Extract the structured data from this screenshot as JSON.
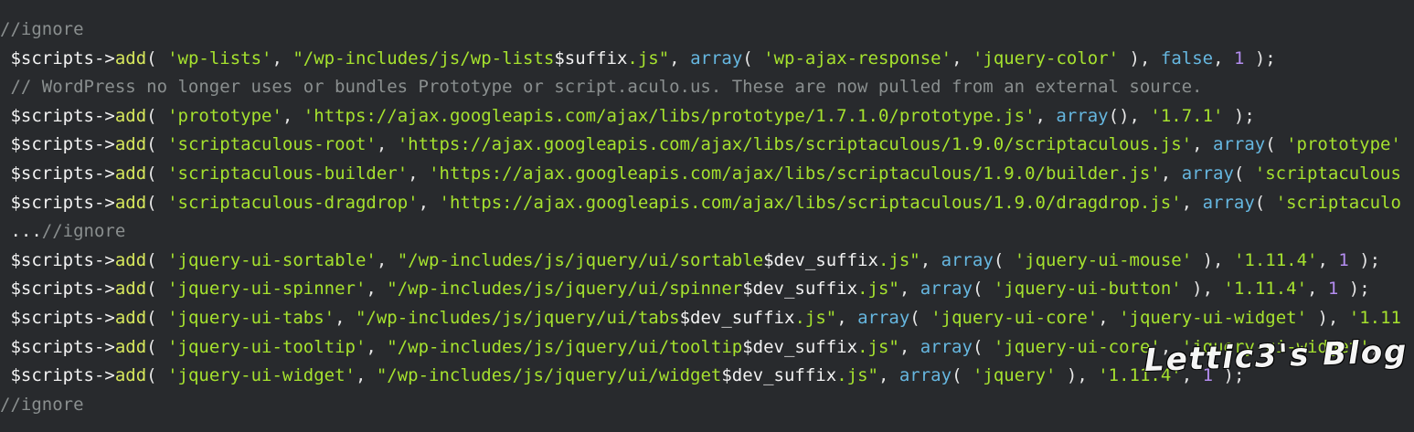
{
  "watermark": "Lettic3's Blog",
  "lines": [
    [
      [
        "com",
        "//ignore"
      ]
    ],
    [
      [
        "var",
        " $scripts->"
      ],
      [
        "fn",
        "add"
      ],
      [
        "plain",
        "( "
      ],
      [
        "str",
        "'wp-lists'"
      ],
      [
        "plain",
        ", "
      ],
      [
        "str",
        "\"/wp-includes/js/wp-lists"
      ],
      [
        "var",
        "$suffix"
      ],
      [
        "str",
        ".js\""
      ],
      [
        "plain",
        ", "
      ],
      [
        "kw",
        "array"
      ],
      [
        "plain",
        "( "
      ],
      [
        "str",
        "'wp-ajax-response'"
      ],
      [
        "plain",
        ", "
      ],
      [
        "str",
        "'jquery-color'"
      ],
      [
        "plain",
        " ), "
      ],
      [
        "kw",
        "false"
      ],
      [
        "plain",
        ", "
      ],
      [
        "num",
        "1"
      ],
      [
        "plain",
        " );"
      ]
    ],
    [
      [
        "com",
        " // WordPress no longer uses or bundles Prototype or script.aculo.us. These are now pulled from an external source."
      ]
    ],
    [
      [
        "var",
        " $scripts->"
      ],
      [
        "fn",
        "add"
      ],
      [
        "plain",
        "( "
      ],
      [
        "str",
        "'prototype'"
      ],
      [
        "plain",
        ", "
      ],
      [
        "str",
        "'https://ajax.googleapis.com/ajax/libs/prototype/1.7.1.0/prototype.js'"
      ],
      [
        "plain",
        ", "
      ],
      [
        "kw",
        "array"
      ],
      [
        "plain",
        "(), "
      ],
      [
        "str",
        "'1.7.1'"
      ],
      [
        "plain",
        " );"
      ]
    ],
    [
      [
        "var",
        " $scripts->"
      ],
      [
        "fn",
        "add"
      ],
      [
        "plain",
        "( "
      ],
      [
        "str",
        "'scriptaculous-root'"
      ],
      [
        "plain",
        ", "
      ],
      [
        "str",
        "'https://ajax.googleapis.com/ajax/libs/scriptaculous/1.9.0/scriptaculous.js'"
      ],
      [
        "plain",
        ", "
      ],
      [
        "kw",
        "array"
      ],
      [
        "plain",
        "( "
      ],
      [
        "str",
        "'prototype'"
      ]
    ],
    [
      [
        "var",
        " $scripts->"
      ],
      [
        "fn",
        "add"
      ],
      [
        "plain",
        "( "
      ],
      [
        "str",
        "'scriptaculous-builder'"
      ],
      [
        "plain",
        ", "
      ],
      [
        "str",
        "'https://ajax.googleapis.com/ajax/libs/scriptaculous/1.9.0/builder.js'"
      ],
      [
        "plain",
        ", "
      ],
      [
        "kw",
        "array"
      ],
      [
        "plain",
        "( "
      ],
      [
        "str",
        "'scriptaculous"
      ]
    ],
    [
      [
        "var",
        " $scripts->"
      ],
      [
        "fn",
        "add"
      ],
      [
        "plain",
        "( "
      ],
      [
        "str",
        "'scriptaculous-dragdrop'"
      ],
      [
        "plain",
        ", "
      ],
      [
        "str",
        "'https://ajax.googleapis.com/ajax/libs/scriptaculous/1.9.0/dragdrop.js'"
      ],
      [
        "plain",
        ", "
      ],
      [
        "kw",
        "array"
      ],
      [
        "plain",
        "( "
      ],
      [
        "str",
        "'scriptaculo"
      ]
    ],
    [
      [
        "plain",
        " ..."
      ],
      [
        "com",
        "//ignore"
      ]
    ],
    [
      [
        "var",
        " $scripts->"
      ],
      [
        "fn",
        "add"
      ],
      [
        "plain",
        "( "
      ],
      [
        "str",
        "'jquery-ui-sortable'"
      ],
      [
        "plain",
        ", "
      ],
      [
        "str",
        "\"/wp-includes/js/jquery/ui/sortable"
      ],
      [
        "var",
        "$dev_suffix"
      ],
      [
        "str",
        ".js\""
      ],
      [
        "plain",
        ", "
      ],
      [
        "kw",
        "array"
      ],
      [
        "plain",
        "( "
      ],
      [
        "str",
        "'jquery-ui-mouse'"
      ],
      [
        "plain",
        " ), "
      ],
      [
        "str",
        "'1.11.4'"
      ],
      [
        "plain",
        ", "
      ],
      [
        "num",
        "1"
      ],
      [
        "plain",
        " );"
      ]
    ],
    [
      [
        "var",
        " $scripts->"
      ],
      [
        "fn",
        "add"
      ],
      [
        "plain",
        "( "
      ],
      [
        "str",
        "'jquery-ui-spinner'"
      ],
      [
        "plain",
        ", "
      ],
      [
        "str",
        "\"/wp-includes/js/jquery/ui/spinner"
      ],
      [
        "var",
        "$dev_suffix"
      ],
      [
        "str",
        ".js\""
      ],
      [
        "plain",
        ", "
      ],
      [
        "kw",
        "array"
      ],
      [
        "plain",
        "( "
      ],
      [
        "str",
        "'jquery-ui-button'"
      ],
      [
        "plain",
        " ), "
      ],
      [
        "str",
        "'1.11.4'"
      ],
      [
        "plain",
        ", "
      ],
      [
        "num",
        "1"
      ],
      [
        "plain",
        " );"
      ]
    ],
    [
      [
        "var",
        " $scripts->"
      ],
      [
        "fn",
        "add"
      ],
      [
        "plain",
        "( "
      ],
      [
        "str",
        "'jquery-ui-tabs'"
      ],
      [
        "plain",
        ", "
      ],
      [
        "str",
        "\"/wp-includes/js/jquery/ui/tabs"
      ],
      [
        "var",
        "$dev_suffix"
      ],
      [
        "str",
        ".js\""
      ],
      [
        "plain",
        ", "
      ],
      [
        "kw",
        "array"
      ],
      [
        "plain",
        "( "
      ],
      [
        "str",
        "'jquery-ui-core'"
      ],
      [
        "plain",
        ", "
      ],
      [
        "str",
        "'jquery-ui-widget'"
      ],
      [
        "plain",
        " ), "
      ],
      [
        "str",
        "'1.11"
      ]
    ],
    [
      [
        "var",
        " $scripts->"
      ],
      [
        "fn",
        "add"
      ],
      [
        "plain",
        "( "
      ],
      [
        "str",
        "'jquery-ui-tooltip'"
      ],
      [
        "plain",
        ", "
      ],
      [
        "str",
        "\"/wp-includes/js/jquery/ui/tooltip"
      ],
      [
        "var",
        "$dev_suffix"
      ],
      [
        "str",
        ".js\""
      ],
      [
        "plain",
        ", "
      ],
      [
        "kw",
        "array"
      ],
      [
        "plain",
        "( "
      ],
      [
        "str",
        "'jquery-ui-core'"
      ],
      [
        "plain",
        ", "
      ],
      [
        "str",
        "'jquery-ui-widget'"
      ],
      [
        "plain",
        ", "
      ]
    ],
    [
      [
        "var",
        " $scripts->"
      ],
      [
        "fn",
        "add"
      ],
      [
        "plain",
        "( "
      ],
      [
        "str",
        "'jquery-ui-widget'"
      ],
      [
        "plain",
        ", "
      ],
      [
        "str",
        "\"/wp-includes/js/jquery/ui/widget"
      ],
      [
        "var",
        "$dev_suffix"
      ],
      [
        "str",
        ".js\""
      ],
      [
        "plain",
        ", "
      ],
      [
        "kw",
        "array"
      ],
      [
        "plain",
        "( "
      ],
      [
        "str",
        "'jquery'"
      ],
      [
        "plain",
        " ), "
      ],
      [
        "str",
        "'1.11.4'"
      ],
      [
        "plain",
        ", "
      ],
      [
        "num",
        "1"
      ],
      [
        "plain",
        " );"
      ]
    ],
    [
      [
        "com",
        "//ignore"
      ]
    ]
  ]
}
